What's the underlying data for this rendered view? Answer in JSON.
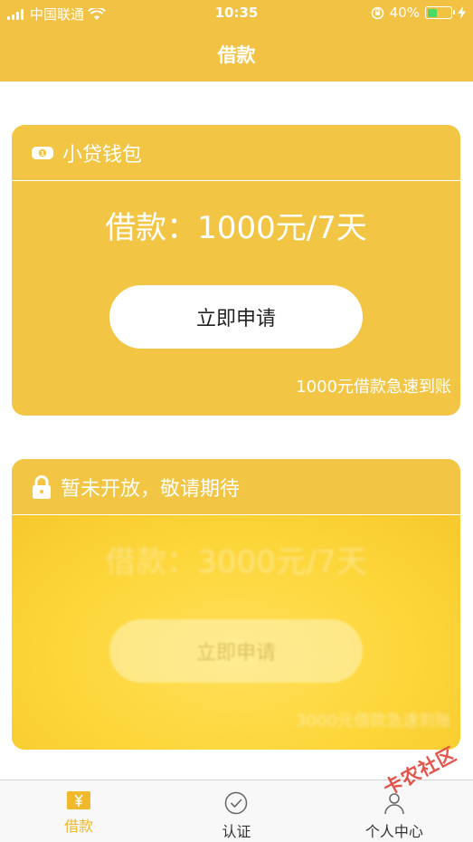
{
  "status": {
    "carrier": "中国联通",
    "time": "10:35",
    "battery": "40%",
    "battery_level": 0.4,
    "battery_color": "#4cd964"
  },
  "nav": {
    "title": "借款"
  },
  "card1": {
    "header_icon": "money-note-icon",
    "header_title": "小贷钱包",
    "amount_text": "借款：1000元/7天",
    "button_label": "立即申请",
    "note": "1000元借款急速到账"
  },
  "card2": {
    "header_icon": "lock-icon",
    "header_title": "暂未开放，敬请期待",
    "amount_text": "借款：3000元/7天",
    "button_label": "立即申请",
    "note": "3000元借款急速到账"
  },
  "tabs": [
    {
      "label": "借款",
      "icon": "yen-wallet-icon",
      "active": true
    },
    {
      "label": "认证",
      "icon": "check-circle-icon",
      "active": false
    },
    {
      "label": "个人中心",
      "icon": "person-icon",
      "active": false
    }
  ],
  "watermark": "卡农社区",
  "colors": {
    "brand": "#f2c244",
    "tab_active": "#f0b92c",
    "watermark": "#e2463c"
  }
}
